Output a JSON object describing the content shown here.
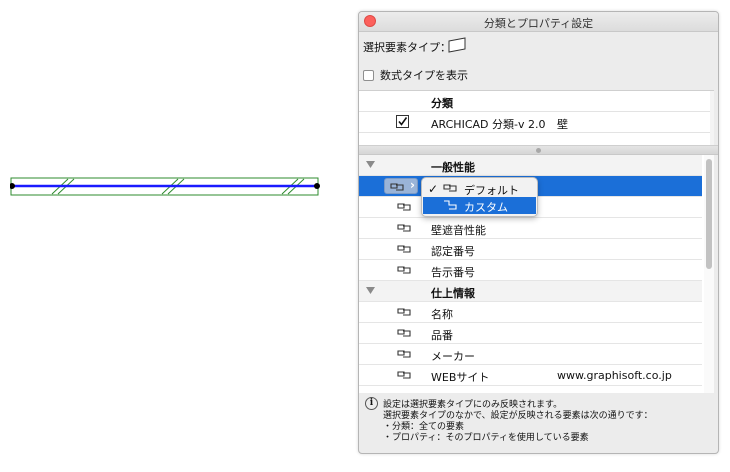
{
  "dialog": {
    "title": "分類とプロパティ設定",
    "element_type_label": "選択要素タイプ：",
    "show_math_label": "数式タイプを表示"
  },
  "classification": {
    "header": "分類",
    "row": {
      "system": "ARCHICAD 分類-v 2.0",
      "value": "壁",
      "checked": true
    }
  },
  "properties": {
    "groups": [
      {
        "name": "一般性能",
        "expanded": true,
        "items": [
          {
            "name": ""
          },
          {
            "name": ""
          },
          {
            "name": "壁遮音性能"
          },
          {
            "name": "認定番号"
          },
          {
            "name": "告示番号"
          }
        ]
      },
      {
        "name": "仕上情報",
        "expanded": true,
        "items": [
          {
            "name": "名称"
          },
          {
            "name": "品番"
          },
          {
            "name": "メーカー"
          },
          {
            "name": "WEBサイト",
            "value": "www.graphisoft.co.jp"
          }
        ]
      }
    ]
  },
  "popup": {
    "items": [
      {
        "label": "デフォルト",
        "checked": true
      },
      {
        "label": "カスタム",
        "highlighted": true
      }
    ]
  },
  "info": {
    "lines": [
      "設定は選択要素タイプにのみ反映されます。",
      "選択要素タイプのなかで、設定が反映される要素は次の通りです：",
      "・分類：全ての要素",
      "・プロパティ：そのプロパティを使用している要素"
    ]
  },
  "colors": {
    "selection": "#1b6fd8",
    "wall_outline": "#2e8b2e",
    "wall_line": "#1a1aff"
  }
}
